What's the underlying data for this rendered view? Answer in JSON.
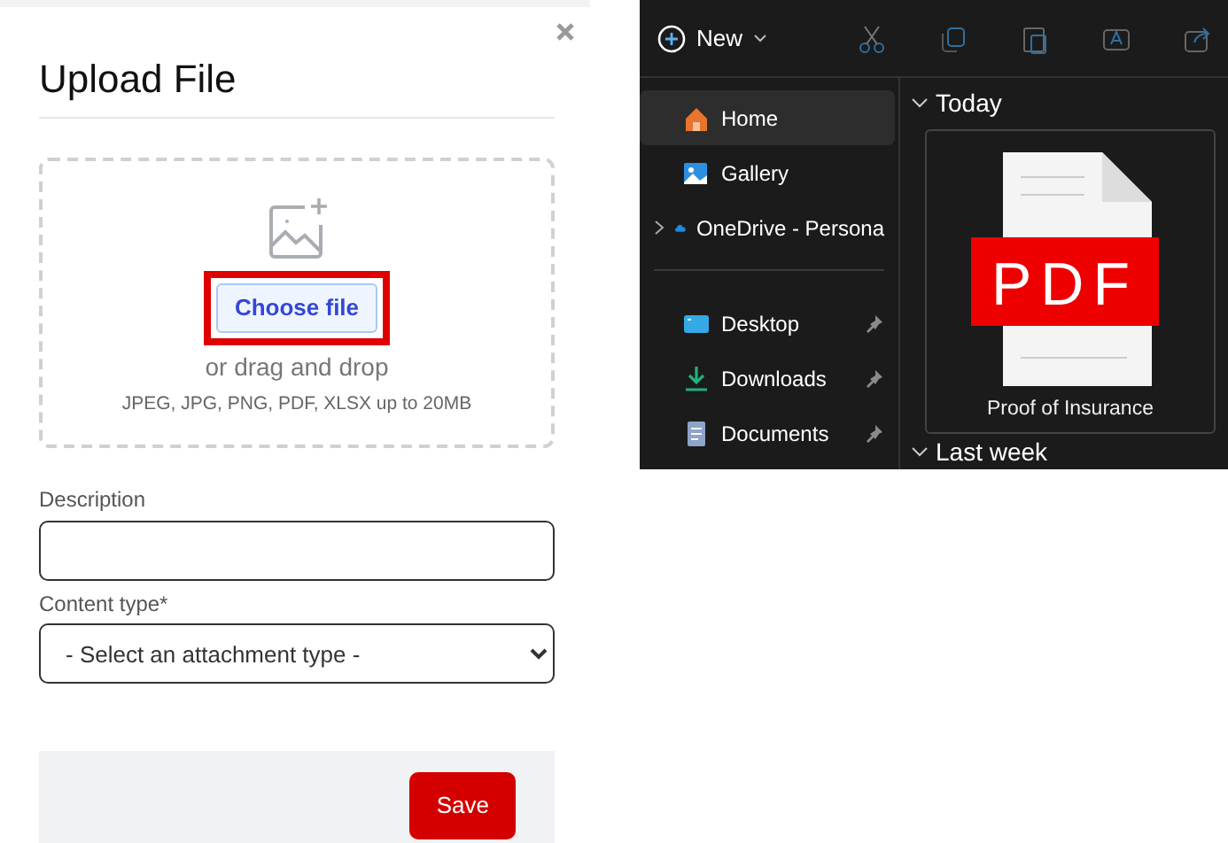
{
  "dialog": {
    "title": "Upload File",
    "dropzone": {
      "button": "Choose file",
      "highlighted": true,
      "hint": "or drag and drop",
      "formats": "JPEG, JPG, PNG, PDF, XLSX up to 20MB"
    },
    "fields": [
      {
        "kind": "text",
        "label": "Description"
      },
      {
        "kind": "select",
        "label": "Content type*",
        "value": "- Select an attachment type -"
      }
    ],
    "save": "Save"
  },
  "explorer": {
    "toolbar": {
      "new": "New"
    },
    "sidebar": {
      "groups": [
        {
          "items": [
            {
              "kind": "home",
              "label": "Home",
              "selected": true,
              "expandable": false,
              "pinned": false
            },
            {
              "kind": "gallery",
              "label": "Gallery",
              "selected": false,
              "expandable": false,
              "pinned": false
            },
            {
              "kind": "cloud",
              "label": "OneDrive - Persona",
              "selected": false,
              "expandable": true,
              "pinned": false
            }
          ]
        },
        {
          "items": [
            {
              "kind": "desktop",
              "label": "Desktop",
              "selected": false,
              "expandable": false,
              "pinned": true
            },
            {
              "kind": "download",
              "label": "Downloads",
              "selected": false,
              "expandable": false,
              "pinned": true
            },
            {
              "kind": "document",
              "label": "Documents",
              "selected": false,
              "expandable": false,
              "pinned": true
            }
          ]
        }
      ]
    },
    "sections": [
      {
        "title": "Today",
        "expanded": true,
        "files": [
          {
            "name": "Proof of Insurance",
            "badge": "PDF"
          }
        ]
      },
      {
        "title": "Last week",
        "expanded": true
      }
    ]
  }
}
